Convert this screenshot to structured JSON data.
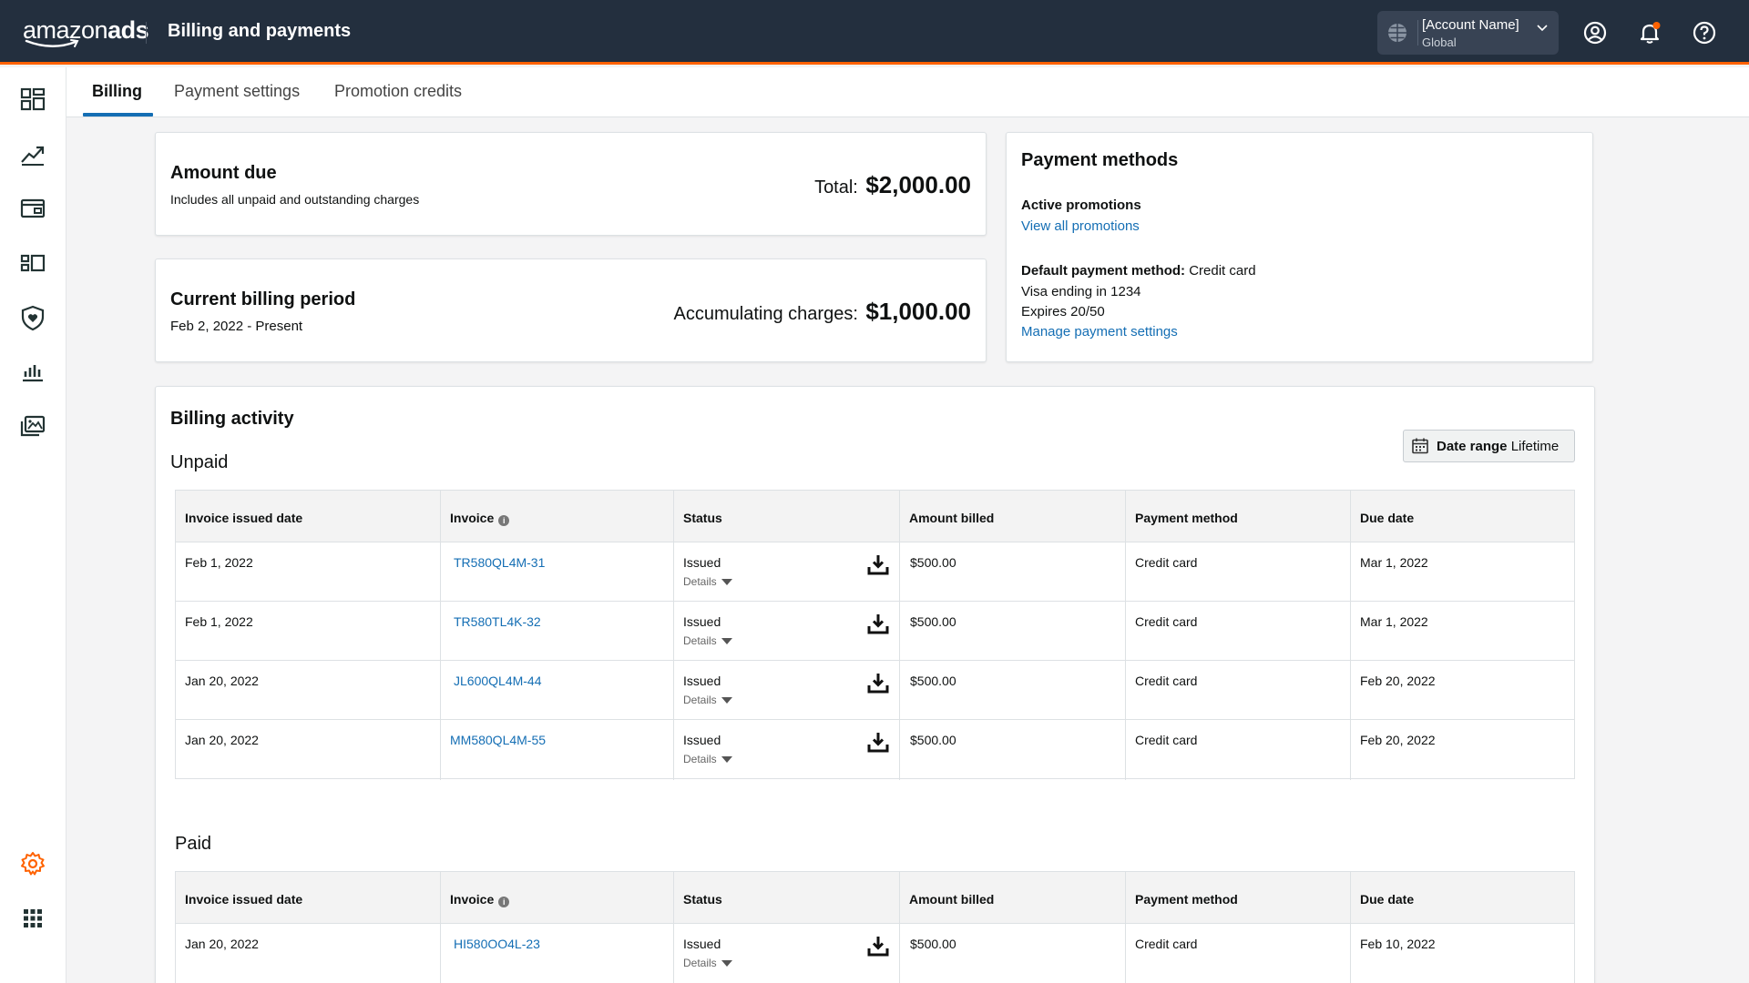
{
  "header": {
    "logo_word1": "amazon",
    "logo_word2": "ads",
    "title": "Billing and payments",
    "account_name": "[Account Name]",
    "account_region": "Global",
    "icons": [
      "globe-icon",
      "chevron-down-icon",
      "user-circle-icon",
      "bell-icon",
      "help-icon"
    ],
    "notification_dot_color": "#ff6200"
  },
  "rail": {
    "icons": [
      "dashboard-icon",
      "trend-icon",
      "wallet-icon",
      "campaigns-icon",
      "shield-heart-icon",
      "bar-chart-icon",
      "media-icon",
      "settings-icon",
      "apps-grid-icon"
    ],
    "active_color": "#ff6200"
  },
  "tabs": [
    {
      "label": "Billing",
      "active": true
    },
    {
      "label": "Payment settings",
      "active": false
    },
    {
      "label": "Promotion credits",
      "active": false
    }
  ],
  "amount_due": {
    "title": "Amount due",
    "subtitle": "Includes all unpaid and outstanding charges",
    "total_label": "Total:",
    "total_value": "$2,000.00"
  },
  "billing_period": {
    "title": "Current billing period",
    "dates": "Feb 2, 2022 - Present",
    "charges_label": "Accumulating charges:",
    "charges_value": "$1,000.00"
  },
  "payment_methods": {
    "title": "Payment methods",
    "promotions_label": "Active promotions",
    "promotions_link": "View all promotions",
    "default_label": "Default payment method:",
    "default_value": "Credit card",
    "card_line": "Visa ending in 1234",
    "expires": "Expires 20/50",
    "manage_link": "Manage payment settings"
  },
  "activity": {
    "title": "Billing activity",
    "date_range_label": "Date range",
    "date_range_value": "Lifetime",
    "columns": [
      "Invoice issued date",
      "Invoice",
      "Status",
      "Amount billed",
      "Payment method",
      "Due date"
    ],
    "details_label": "Details",
    "unpaid": {
      "title": "Unpaid",
      "rows": [
        {
          "date": "Feb 1, 2022",
          "invoice": "TR580QL4M-31",
          "status": "Issued",
          "amount": "$500.00",
          "method": "Credit card",
          "due": "Mar 1, 2022"
        },
        {
          "date": "Feb 1, 2022",
          "invoice": "TR580TL4K-32",
          "status": "Issued",
          "amount": "$500.00",
          "method": "Credit card",
          "due": "Mar 1, 2022"
        },
        {
          "date": "Jan 20, 2022",
          "invoice": "JL600QL4M-44",
          "status": "Issued",
          "amount": "$500.00",
          "method": "Credit card",
          "due": "Feb 20, 2022"
        },
        {
          "date": "Jan 20, 2022",
          "invoice": "MM580QL4M-55",
          "status": "Issued",
          "amount": "$500.00",
          "method": "Credit card",
          "due": "Feb 20, 2022"
        }
      ]
    },
    "paid": {
      "title": "Paid",
      "rows": [
        {
          "date": "Jan 20, 2022",
          "invoice": "HI580OO4L-23",
          "status": "Issued",
          "amount": "$500.00",
          "method": "Credit card",
          "due": "Feb 10, 2022"
        }
      ]
    }
  },
  "colors": {
    "topbar": "#232f3e",
    "accent_orange": "#ff6200",
    "link_blue": "#146eb4"
  }
}
